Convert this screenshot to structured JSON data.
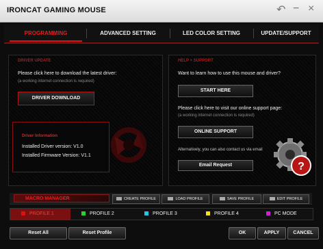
{
  "window": {
    "title": "IRONCAT GAMING MOUSE",
    "controls": {
      "back": "↶",
      "minimize": "−",
      "close": "×"
    }
  },
  "tabs": [
    {
      "label": "PROGRAMMING",
      "active": true
    },
    {
      "label": "ADVANCED SETTING",
      "active": false
    },
    {
      "label": "LED COLOR SETTING",
      "active": false
    },
    {
      "label": "UPDATE/SUPPORT",
      "active": false
    }
  ],
  "driver_update": {
    "title": "DRIVER UPDATE",
    "prompt": "Please click here to download the latest driver:",
    "note": "(a working internet connection is required)",
    "button": "DRIVER DOWNLOAD",
    "info_title": "Driver Information",
    "driver_version": "Installed Driver version: V1.0",
    "firmware_version": "Installed Firmware Version: V1.1"
  },
  "help": {
    "title": "HELP + SUPPORT",
    "prompt1": "Want to learn how to use this mouse and driver?",
    "start_button": "START HERE",
    "prompt2": "Please click here to visit our online support page:",
    "note": "(a working internet connection is required)",
    "support_button": "ONLINE SUPPORT",
    "alt_text": "Alternatively, you can also contact us via email",
    "email_button": "Email Request"
  },
  "macro": {
    "label": "MACRO MANAGER",
    "buttons": [
      "CREATE PROFILE",
      "LOAD PROFILE",
      "SAVE PROFILE",
      "EDIT PROFILE"
    ]
  },
  "profiles": [
    {
      "label": "PROFILE 1",
      "color": "#e01010",
      "active": true
    },
    {
      "label": "PROFILE 2",
      "color": "#2ad12a",
      "active": false
    },
    {
      "label": "PROFILE 3",
      "color": "#27c3e6",
      "active": false
    },
    {
      "label": "PROFILE 4",
      "color": "#f3e21b",
      "active": false
    },
    {
      "label": "PC MODE",
      "color": "#d11fd1",
      "active": false
    }
  ],
  "bottom_buttons": {
    "reset_all": "Reset All",
    "reset_profile": "Reset Profile",
    "ok": "OK",
    "apply": "APPLY",
    "cancel": "CANCEL"
  },
  "accent_color": "#c41414"
}
